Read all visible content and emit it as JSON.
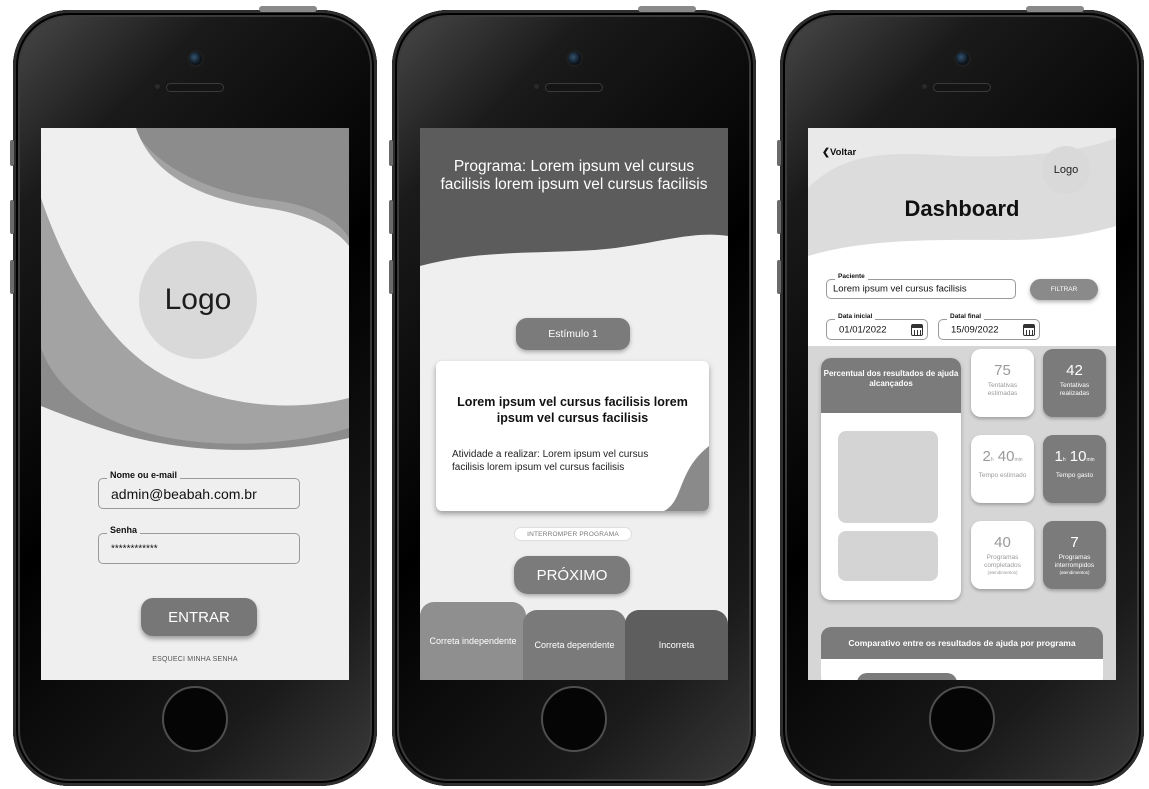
{
  "login": {
    "logo": "Logo",
    "user_label": "Nome ou e-mail",
    "user_value": "admin@beabah.com.br",
    "password_label": "Senha",
    "password_value": "************",
    "enter_button": "ENTRAR",
    "forgot_link": "ESQUECI MINHA SENHA"
  },
  "program": {
    "title": "Programa: Lorem ipsum vel cursus facilisis lorem ipsum vel cursus facilisis",
    "stimulus": "Estímulo 1",
    "card_title": "Lorem ipsum vel cursus facilisis lorem ipsum vel cursus facilisis",
    "card_text": "Atividade a realizar: Lorem ipsum vel cursus facilisis lorem ipsum vel cursus facilisis",
    "interrupt": "INTERROMPER PROGRAMA",
    "next": "PRÓXIMO",
    "tabs": [
      {
        "label": "Correta independente",
        "color": "#8f8f8f"
      },
      {
        "label": "Correta dependente",
        "color": "#7a7a7a"
      },
      {
        "label": "Incorreta",
        "color": "#5e5e5e"
      }
    ]
  },
  "dashboard": {
    "back": "Voltar",
    "logo": "Logo",
    "title": "Dashboard",
    "patient_label": "Paciente",
    "patient_value": "Lorem ipsum vel cursus facilisis",
    "filter": "FILTRAR",
    "start_label": "Data inicial",
    "start_value": "01/01/2022",
    "end_label": "Datal final",
    "end_value": "15/09/2022",
    "panel_title": "Percentual dos resultados de ajuda alcançados",
    "stats": {
      "attempts_est_value": "75",
      "attempts_est_label": "Tentativas estimadas",
      "attempts_done_value": "42",
      "attempts_done_label": "Tentativas realizadas",
      "time_est_h": "2",
      "time_est_m": "40",
      "time_est_label": "Tempo estimado",
      "time_spent_h": "1",
      "time_spent_m": "10",
      "time_spent_label": "Tempo gasto",
      "unit_h": "h",
      "unit_min_est": "min",
      "unit_min_spent": "min",
      "programs_done_value": "40",
      "programs_done_label": "Programas completados",
      "programs_int_value": "7",
      "programs_int_label": "Programas interrompidos",
      "sessions_note": "(atendimentos)"
    },
    "compare_title": "Comparativo entre os resultados de ajuda por programa"
  },
  "colors": {
    "dark_gray": "#7b7b7b",
    "screen_bg": "#efefef",
    "header_gray": "#5c5c5c"
  }
}
